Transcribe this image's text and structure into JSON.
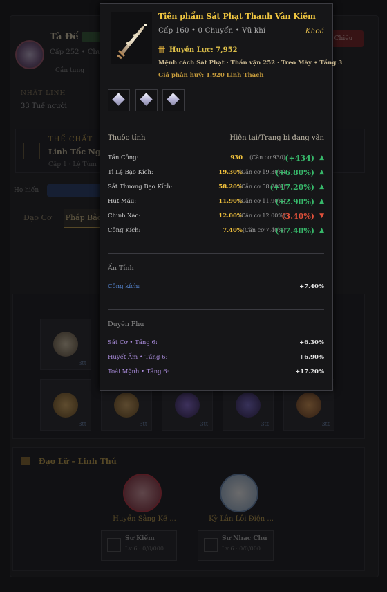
{
  "background": {
    "character": {
      "name": "Tà Đế",
      "level_line": "Cấp 252 • Chu",
      "sub_label": "Cần tung",
      "recruit_button": "Chiêu"
    },
    "section_1": {
      "heading": "NHẬT LINH",
      "value": "33 Tuế người"
    },
    "physique": {
      "heading": "THỂ CHẤT",
      "value": "Linh Tốc Ngọc",
      "detail": "Cấp 1 · Lệ Tùm"
    },
    "filter_label": "Họ hiến",
    "filter_pill": "Tổ Cấp Niên",
    "tabs": [
      "Đạo Cơ",
      "Pháp Bảo"
    ],
    "slot_levels": [
      "3tt",
      "3tt",
      "3tt",
      "3tt",
      "3tt",
      "3tt",
      "3tt"
    ],
    "companions_title": "Đạo Lữ – Linh Thú",
    "companions": [
      {
        "name": "Huyền Sâng Kế ...",
        "box_title": "Sư Kiếm",
        "box_sub": "Lv 6 · 0/0/000"
      },
      {
        "name": "Kỳ Lân Lôi Điện ...",
        "box_title": "Sư Nhạc Chủ",
        "box_sub": "Lv 6 · 0/0/000"
      }
    ]
  },
  "tooltip": {
    "title": "Tiên phẩm Sát Phạt Thanh Vân Kiếm",
    "subtitle": "Cấp 160 • 0 Chuyển • Vũ khí",
    "lock_label": "Khoá",
    "power_icon": "spirit-power-icon",
    "power_label": "Huyền Lực: 7,952",
    "mechanic": "Mệnh cách Sát Phạt · Thần vận 252 · Treo Máy • Tầng 3",
    "decompose": "Giá phân huỷ: 1.920 Linh Thạch",
    "gems": [
      "gem-diamond-icon",
      "gem-diamond-icon",
      "gem-diamond-icon"
    ],
    "attributes_heading": "Thuộc tính",
    "attributes_compare_heading": "Hiện tại/Trang bị đang vận",
    "attributes": [
      {
        "label": "Tấn Công:",
        "value": "930",
        "base": "(Căn cơ 930)",
        "diff": "(+434)",
        "direction": "up",
        "arrow": "▲"
      },
      {
        "label": "Tỉ Lệ Bạo Kích:",
        "value": "19.30%",
        "base": "(Căn cơ 19.30%)",
        "diff": "(+6.80%)",
        "direction": "up",
        "arrow": "▲"
      },
      {
        "label": "Sát Thương Bạo Kích:",
        "value": "58.20%",
        "base": "(Căn cơ 58.20%)",
        "diff": "(+17.20%)",
        "direction": "up",
        "arrow": "▲"
      },
      {
        "label": "Hút Máu:",
        "value": "11.90%",
        "base": "(Căn cơ 11.90%)",
        "diff": "(+2.90%)",
        "direction": "up",
        "arrow": "▲"
      },
      {
        "label": "Chính Xác:",
        "value": "12.00%",
        "base": "(Căn cơ 12.00%)",
        "diff": "(3.40%)",
        "direction": "down",
        "arrow": "▼"
      },
      {
        "label": "Công Kích:",
        "value": "7.40%",
        "base": "(Căn cơ 7.40%)",
        "diff": "(+7.40%)",
        "direction": "up",
        "arrow": "▲"
      }
    ],
    "hidden_heading": "Ẩn Tính",
    "hidden": [
      {
        "label": "Công kích:",
        "value": "+7.40%"
      }
    ],
    "bond_heading": "Duyên Phụ",
    "bonds": [
      {
        "label": "Sát Cơ • Tầng 6:",
        "value": "+6.30%"
      },
      {
        "label": "Huyết Ấm • Tầng 6:",
        "value": "+6.90%"
      },
      {
        "label": "Toái Mệnh • Tầng 6:",
        "value": "+17.20%"
      }
    ],
    "colors": {
      "title": "#f0c640",
      "up": "#37b86a",
      "down": "#e0503a",
      "hidden": "#5b8fe0",
      "bond": "#a78ad8"
    }
  }
}
